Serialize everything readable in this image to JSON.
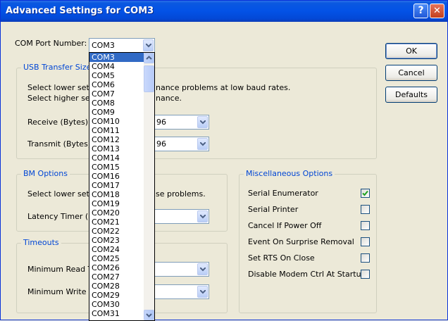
{
  "window": {
    "title": "Advanced Settings for COM3",
    "help_button": "?",
    "close_button": "✕"
  },
  "com_port": {
    "label": "COM Port Number:",
    "value": "COM3",
    "options": [
      "COM3",
      "COM4",
      "COM5",
      "COM6",
      "COM7",
      "COM8",
      "COM9",
      "COM10",
      "COM11",
      "COM12",
      "COM13",
      "COM14",
      "COM15",
      "COM16",
      "COM17",
      "COM18",
      "COM19",
      "COM20",
      "COM21",
      "COM22",
      "COM23",
      "COM24",
      "COM25",
      "COM26",
      "COM27",
      "COM28",
      "COM29",
      "COM30",
      "COM31"
    ]
  },
  "buttons": {
    "ok": "OK",
    "cancel": "Cancel",
    "defaults": "Defaults"
  },
  "usb_transfer": {
    "title": "USB Transfer Sizes",
    "line1": "nance problems at low baud rates.",
    "line2": "nance.",
    "line1_prefix": "Select lower settin",
    "line2_prefix": "Select higher settin",
    "receive_label": "Receive (Bytes):",
    "receive_value": "96",
    "transmit_label": "Transmit (Bytes):",
    "transmit_value": "96"
  },
  "bm_options": {
    "title": "BM Options",
    "line_prefix": "Select lower settin",
    "line_suffix": "se problems.",
    "latency_label": "Latency Timer (mse"
  },
  "timeouts": {
    "title": "Timeouts",
    "min_read_label": "Minimum Read Tim",
    "min_write_label": "Minimum Write Tim"
  },
  "misc": {
    "title": "Miscellaneous Options",
    "options": [
      {
        "label": "Serial Enumerator",
        "checked": true
      },
      {
        "label": "Serial Printer",
        "checked": false
      },
      {
        "label": "Cancel If Power Off",
        "checked": false
      },
      {
        "label": "Event On Surprise Removal",
        "checked": false
      },
      {
        "label": "Set RTS On Close",
        "checked": false
      },
      {
        "label": "Disable Modem Ctrl At Startup",
        "checked": false
      }
    ]
  },
  "colors": {
    "titlebar": "#0352e6",
    "group_title": "#0046d5",
    "selection": "#316ac5",
    "check": "#21a121"
  },
  "icons": [
    "help-icon",
    "close-icon",
    "chevron-down-icon",
    "checkmark-icon",
    "scroll-up-icon",
    "scroll-down-icon"
  ]
}
